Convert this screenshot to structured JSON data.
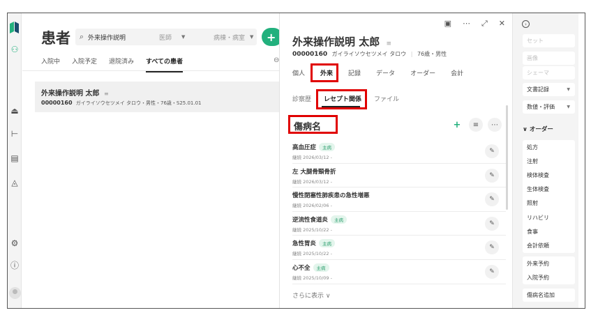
{
  "nav": {
    "brand_color": "#22b07d"
  },
  "list": {
    "title": "患者",
    "search_value": "外来操作説明",
    "filter_doctor": "医師",
    "filter_ward": "病棟・病室",
    "add_label": "+",
    "tabs": [
      "入院中",
      "入院予定",
      "退院済み",
      "すべての患者"
    ],
    "active_tab": "すべての患者",
    "patient": {
      "name": "外来操作説明 太郎",
      "id": "00000160",
      "info": "ガイライソウセツメイ タロウ・男性・76歳・S25.01.01"
    }
  },
  "detail": {
    "name": "外来操作説明 太郎",
    "id": "00000160",
    "kana": "ガイライソウセツメイ タロウ",
    "age_sex": "76歳・男性",
    "main_tabs": [
      "個人",
      "外来",
      "記録",
      "データ",
      "オーダー",
      "会計"
    ],
    "sub_tabs": [
      "診察歴",
      "レセプト関係",
      "ファイル"
    ],
    "section_title": "傷病名",
    "diseases": [
      {
        "name": "高血圧症",
        "badge": "主病",
        "date": "継続 2026/03/12 -"
      },
      {
        "name": "左 大腿骨頸骨折",
        "badge": "",
        "date": "継続 2026/03/12 -"
      },
      {
        "name": "慢性閉塞性肺疾患の急性増悪",
        "badge": "",
        "date": "継続 2026/02/06 -"
      },
      {
        "name": "逆流性食道炎",
        "badge": "主病",
        "date": "継続 2025/10/22 -"
      },
      {
        "name": "急性胃炎",
        "badge": "主病",
        "date": "継続 2025/10/22 -"
      },
      {
        "name": "心不全",
        "badge": "主病",
        "date": "継続 2025/10/09 -"
      }
    ],
    "more_label": "さらに表示 ∨"
  },
  "right_panel": {
    "items_top": [
      "セット",
      "画像",
      "シェーマ"
    ],
    "doc_record": "文書記録",
    "values_eval": "数値・評価",
    "order_head": "∨ オーダー",
    "orders_a": [
      "処方",
      "注射",
      "検体検査",
      "生体検査",
      "照射",
      "リハビリ",
      "食事",
      "会計依頼"
    ],
    "orders_b": [
      "外来予約",
      "入院予約"
    ],
    "add_disease": "傷病名追加"
  }
}
